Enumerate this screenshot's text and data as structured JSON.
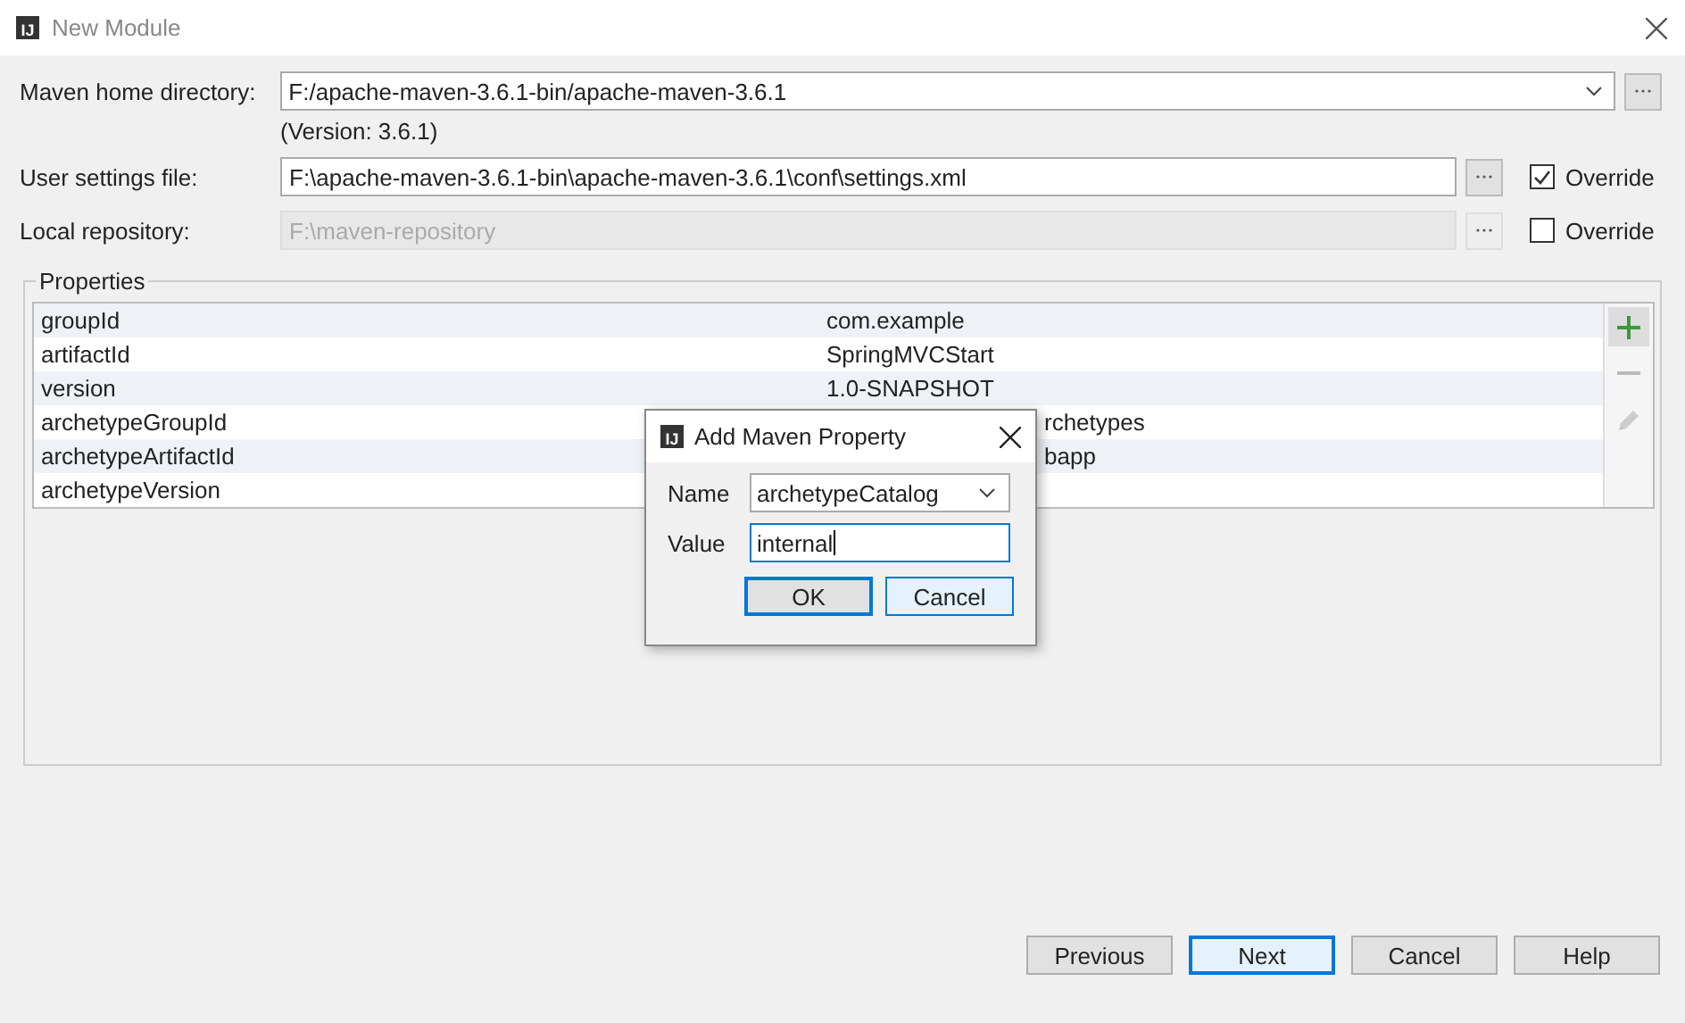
{
  "window": {
    "logo": "IJ",
    "title": "New Module"
  },
  "fields": [
    {
      "kind": "combo",
      "label": "Maven home directory:",
      "value": "F:/apache-maven-3.6.1-bin/apache-maven-3.6.1",
      "disabled": false,
      "note": "(Version: 3.6.1)"
    },
    {
      "kind": "file",
      "label": "User settings file:",
      "value": "F:\\apache-maven-3.6.1-bin\\apache-maven-3.6.1\\conf\\settings.xml",
      "disabled": false,
      "override": {
        "label": "Override",
        "checked": true
      }
    },
    {
      "kind": "file",
      "label": "Local repository:",
      "value": "F:\\maven-repository",
      "disabled": true,
      "override": {
        "label": "Override",
        "checked": false
      }
    }
  ],
  "properties": {
    "title": "Properties",
    "rows": [
      {
        "name": "groupId",
        "value": "com.example"
      },
      {
        "name": "artifactId",
        "value": "SpringMVCStart"
      },
      {
        "name": "version",
        "value": "1.0-SNAPSHOT"
      },
      {
        "name": "archetypeGroupId",
        "value": "rchetypes",
        "covered": true
      },
      {
        "name": "archetypeArtifactId",
        "value": "bapp",
        "covered": true
      },
      {
        "name": "archetypeVersion"
      }
    ]
  },
  "dialog": {
    "logo": "IJ",
    "title": "Add Maven Property",
    "name_label": "Name",
    "name_value": "archetypeCatalog",
    "value_label": "Value",
    "value": "internal",
    "buttons": [
      {
        "label": "OK",
        "default": true
      },
      {
        "label": "Cancel",
        "default": false
      }
    ]
  },
  "buttons": [
    {
      "label": "Previous",
      "default": false
    },
    {
      "label": "Next",
      "default": true
    },
    {
      "label": "Cancel",
      "default": false
    },
    {
      "label": "Help",
      "default": false
    }
  ]
}
